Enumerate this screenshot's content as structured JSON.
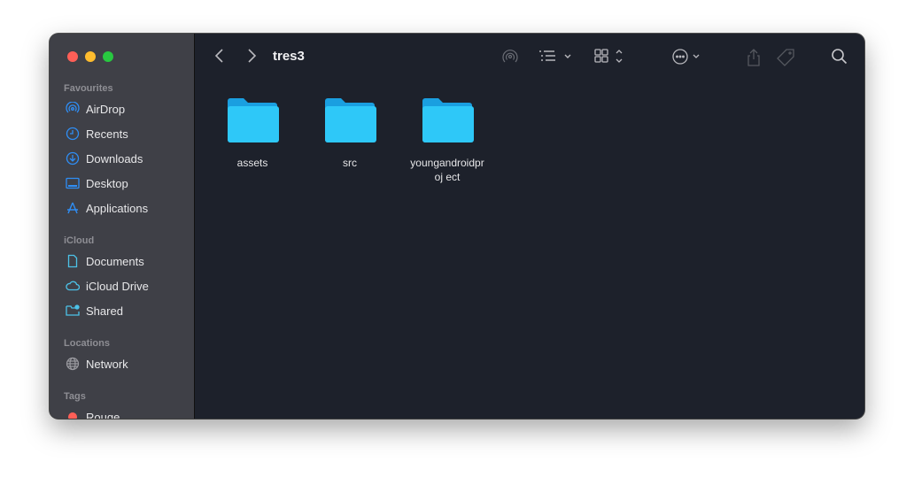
{
  "window": {
    "title": "tres3"
  },
  "sidebar": {
    "sections": [
      {
        "label": "Favourites",
        "items": [
          {
            "label": "AirDrop",
            "icon": "airdrop-icon"
          },
          {
            "label": "Recents",
            "icon": "clock-icon"
          },
          {
            "label": "Downloads",
            "icon": "download-icon"
          },
          {
            "label": "Desktop",
            "icon": "desktop-icon"
          },
          {
            "label": "Applications",
            "icon": "applications-icon"
          }
        ]
      },
      {
        "label": "iCloud",
        "items": [
          {
            "label": "Documents",
            "icon": "document-icon"
          },
          {
            "label": "iCloud Drive",
            "icon": "cloud-icon"
          },
          {
            "label": "Shared",
            "icon": "shared-folder-icon"
          }
        ]
      },
      {
        "label": "Locations",
        "items": [
          {
            "label": "Network",
            "icon": "globe-icon"
          }
        ]
      },
      {
        "label": "Tags",
        "items": [
          {
            "label": "Rouge",
            "icon": "tag-dot-icon"
          }
        ]
      }
    ]
  },
  "files": [
    {
      "name": "assets"
    },
    {
      "name": "src"
    },
    {
      "name": "youngandroidproj ect"
    }
  ],
  "colors": {
    "accent": "#2f8ef5",
    "folder": "#29c3f5",
    "tag_red": "#ff5f57"
  }
}
